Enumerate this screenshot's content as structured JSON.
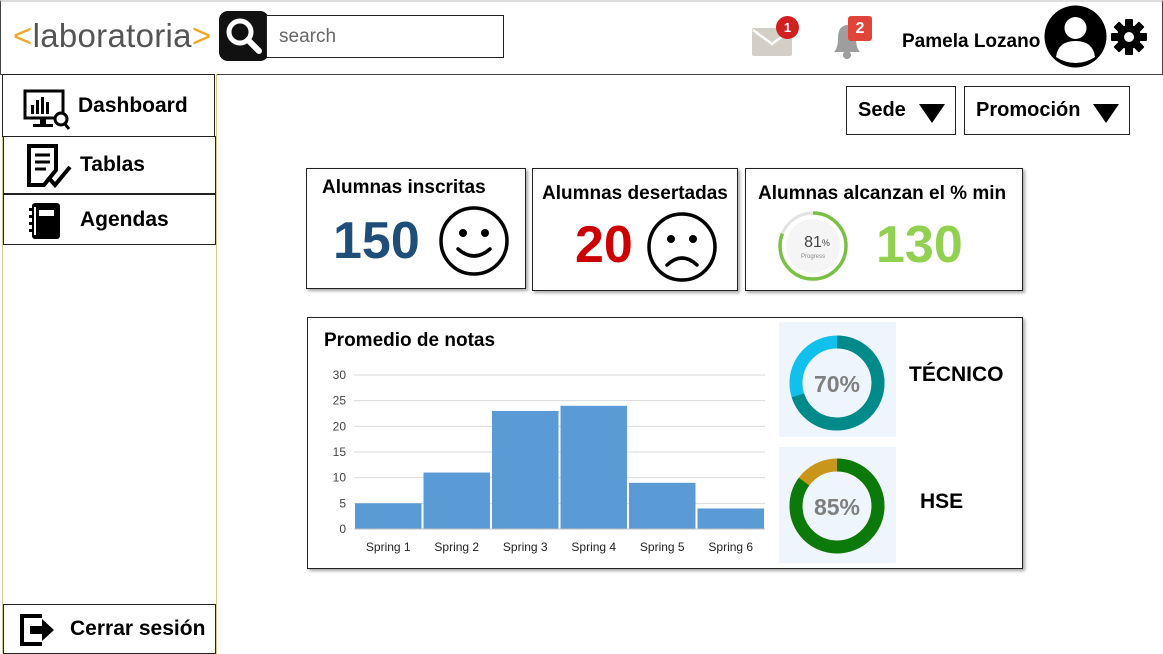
{
  "header": {
    "logo": {
      "open": "<",
      "text": "laboratoria",
      "close": ">"
    },
    "search_placeholder": "search",
    "mail_count": "1",
    "notification_count": "2",
    "user_name": "Pamela Lozano"
  },
  "sidebar": {
    "items": [
      {
        "label": "Dashboard",
        "icon": "dashboard-monitor-icon"
      },
      {
        "label": "Tablas",
        "icon": "document-check-icon"
      },
      {
        "label": "Agendas",
        "icon": "notebook-icon"
      }
    ],
    "logout_label": "Cerrar sesión"
  },
  "filters": {
    "sede": "Sede",
    "promocion": "Promoción"
  },
  "cards": {
    "inscritas": {
      "title": "Alumnas inscritas",
      "value": "150",
      "icon": "smiley-face-icon"
    },
    "desertadas": {
      "title": "Alumnas desertadas",
      "value": "20",
      "icon": "sad-face-icon"
    },
    "alcanzan": {
      "title": "Alumnas alcanzan el % min",
      "value": "130",
      "progress_value": "81",
      "progress_unit": "%",
      "progress_caption": "Progress",
      "progress_fraction": 0.81
    }
  },
  "donuts": [
    {
      "label": "TÉCNICO",
      "value_text": "70%",
      "fraction": 0.7,
      "main_color": "#008a8a",
      "rest_color": "#12c0ee"
    },
    {
      "label": "HSE",
      "value_text": "85%",
      "fraction": 0.85,
      "main_color": "#0b7a0b",
      "rest_color": "#c8961a"
    }
  ],
  "colors": {
    "accent": "#f5a623",
    "blue_number": "#1f4e79",
    "red_number": "#cc0000",
    "green_number": "#92d050",
    "bar": "#5b9bd5"
  },
  "chart_data": {
    "type": "bar",
    "title": "Promedio de notas",
    "categories": [
      "Spring 1",
      "Spring 2",
      "Spring 3",
      "Spring 4",
      "Spring 5",
      "Spring 6"
    ],
    "values": [
      5,
      11,
      23,
      24,
      9,
      4
    ],
    "ylim": [
      0,
      30
    ],
    "yticks": [
      0,
      5,
      10,
      15,
      20,
      25,
      30
    ],
    "grid": true,
    "xlabel": "",
    "ylabel": ""
  }
}
